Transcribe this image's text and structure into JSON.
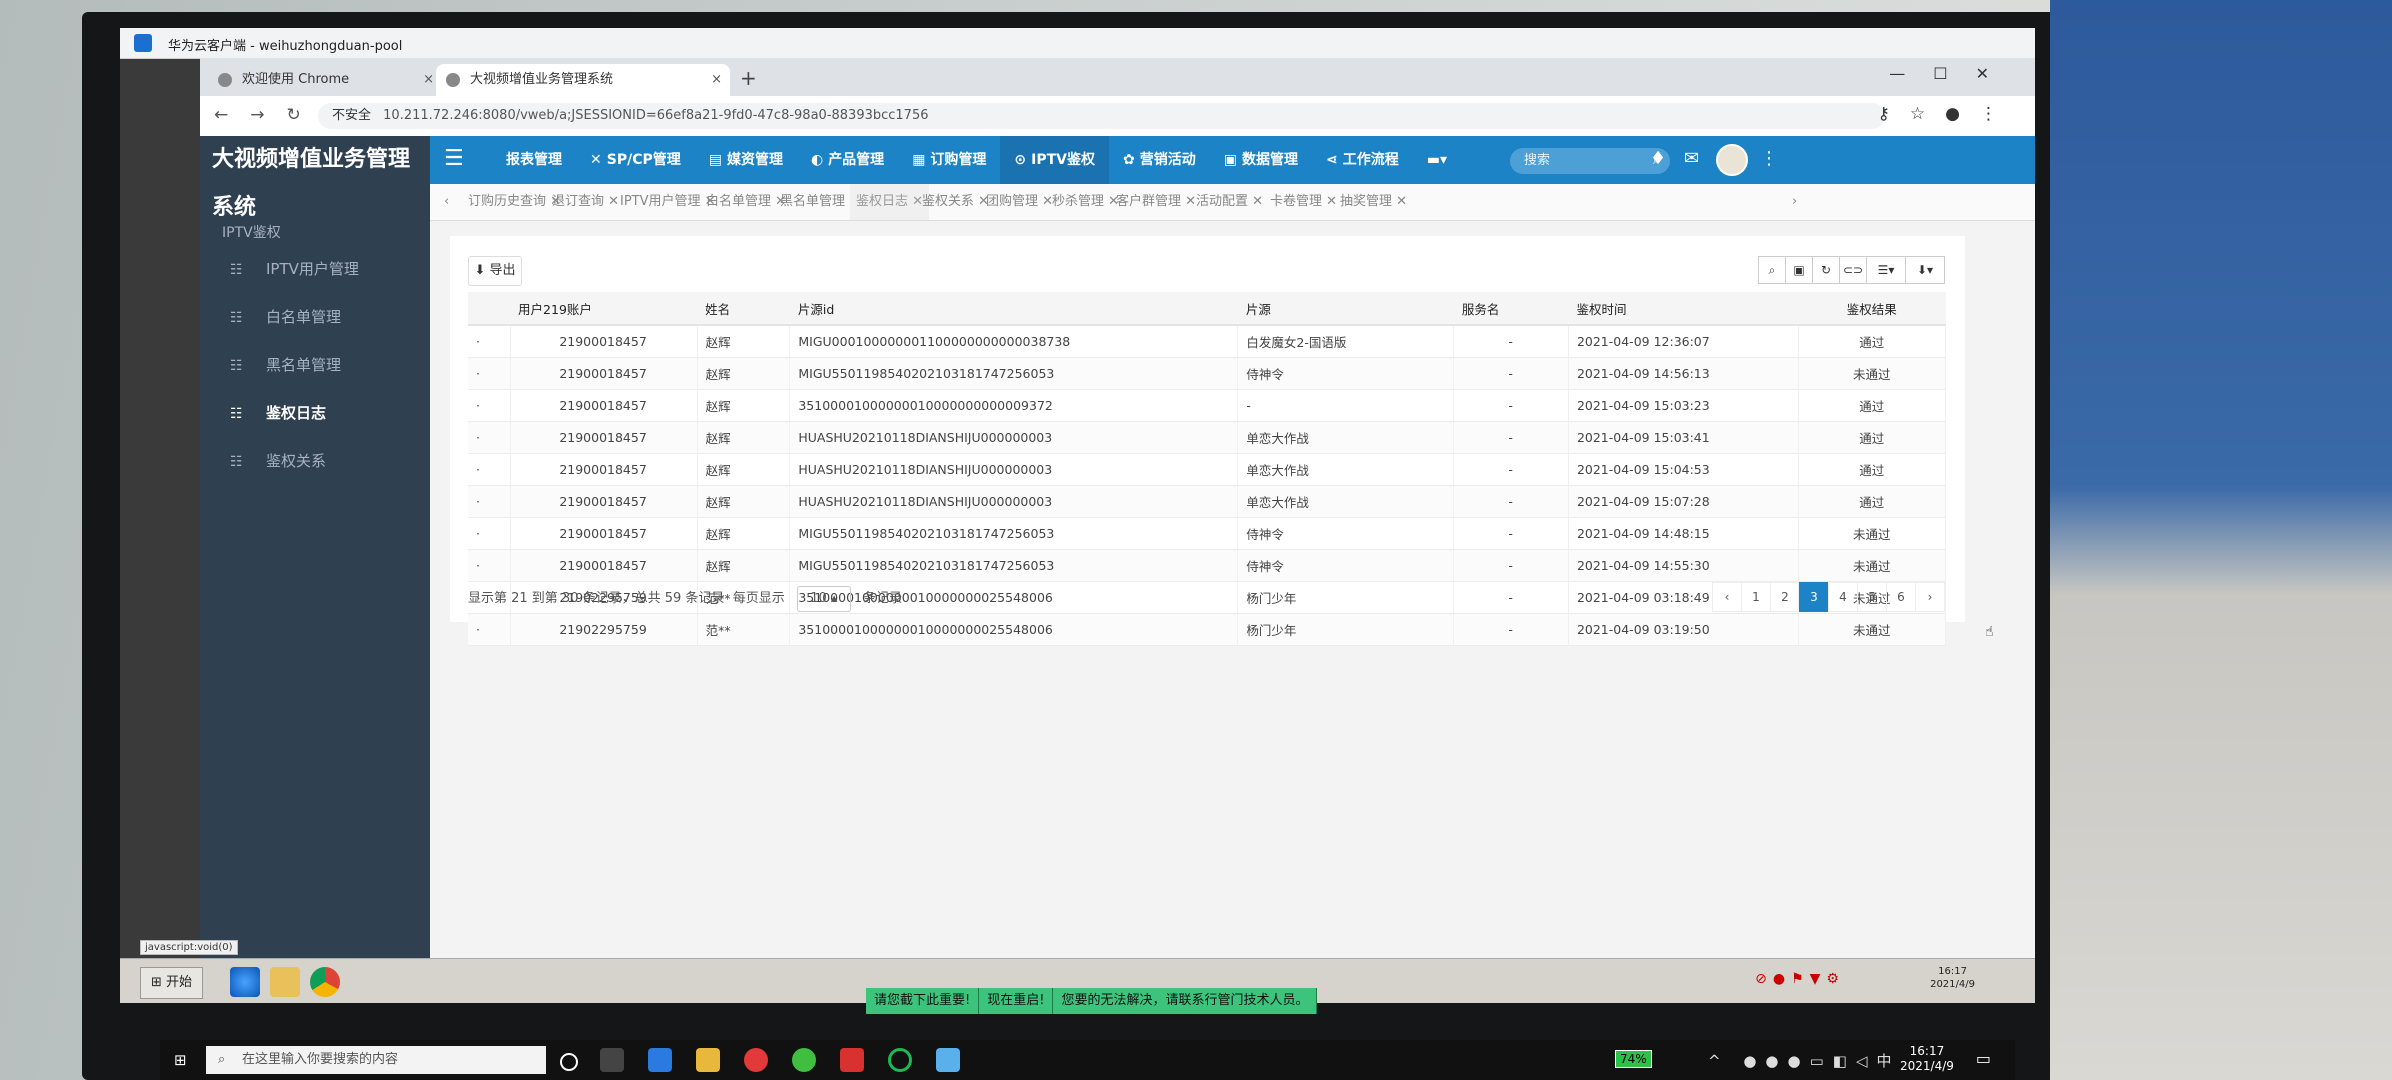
{
  "outer_window": {
    "title": "华为云客户端 - weihuzhongduan-pool"
  },
  "browser": {
    "tabs": [
      {
        "label": "欢迎使用 Chrome"
      },
      {
        "label": "大视频增值业务管理系统"
      }
    ],
    "new_tab": "+",
    "insecure_label": "不安全",
    "url": "10.211.72.246:8080/vweb/a;JSESSIONID=66ef8a21-9fd0-47c8-98a0-88393bcc1756"
  },
  "app": {
    "brand": "大视频增值业务管理系统",
    "sidebar": {
      "heading": "IPTV鉴权",
      "items": [
        {
          "label": "IPTV用户管理"
        },
        {
          "label": "白名单管理"
        },
        {
          "label": "黑名单管理"
        },
        {
          "label": "鉴权日志"
        },
        {
          "label": "鉴权关系"
        }
      ]
    },
    "topnav": [
      {
        "label": "报表管理"
      },
      {
        "label": "SP/CP管理"
      },
      {
        "label": "媒资管理"
      },
      {
        "label": "产品管理"
      },
      {
        "label": "订购管理"
      },
      {
        "label": "IPTV鉴权"
      },
      {
        "label": "营销活动"
      },
      {
        "label": "数据管理"
      },
      {
        "label": "工作流程"
      }
    ],
    "search_placeholder": "搜索",
    "page_tabs": [
      "订购历史查询",
      "退订查询",
      "IPTV用户管理",
      "白名单管理",
      "黑名单管理",
      "鉴权日志",
      "鉴权关系",
      "团购管理",
      "秒杀管理",
      "客户群管理",
      "活动配置",
      "卡卷管理",
      "抽奖管理"
    ],
    "export_label": "导出",
    "table": {
      "headers": [
        "用户219账户",
        "姓名",
        "片源id",
        "片源",
        "服务名",
        "鉴权时间",
        "鉴权结果"
      ],
      "rows": [
        [
          "21900018457",
          "赵辉",
          "MIGU000100000001100000000000038738",
          "白发魔女2-国语版",
          "-",
          "2021-04-09 12:36:07",
          "通过"
        ],
        [
          "21900018457",
          "赵辉",
          "MIGU5501198540202103181747256053",
          "侍神令",
          "-",
          "2021-04-09 14:56:13",
          "未通过"
        ],
        [
          "21900018457",
          "赵辉",
          "35100001000000010000000000009372",
          "-",
          "-",
          "2021-04-09 15:03:23",
          "通过"
        ],
        [
          "21900018457",
          "赵辉",
          "HUASHU20210118DIANSHIJU000000003",
          "单恋大作战",
          "-",
          "2021-04-09 15:03:41",
          "通过"
        ],
        [
          "21900018457",
          "赵辉",
          "HUASHU20210118DIANSHIJU000000003",
          "单恋大作战",
          "-",
          "2021-04-09 15:04:53",
          "通过"
        ],
        [
          "21900018457",
          "赵辉",
          "HUASHU20210118DIANSHIJU000000003",
          "单恋大作战",
          "-",
          "2021-04-09 15:07:28",
          "通过"
        ],
        [
          "21900018457",
          "赵辉",
          "MIGU5501198540202103181747256053",
          "侍神令",
          "-",
          "2021-04-09 14:48:15",
          "未通过"
        ],
        [
          "21900018457",
          "赵辉",
          "MIGU5501198540202103181747256053",
          "侍神令",
          "-",
          "2021-04-09 14:55:30",
          "未通过"
        ],
        [
          "21902295759",
          "范**",
          "35100001000000010000000025548006",
          "杨门少年",
          "-",
          "2021-04-09 03:18:49",
          "未通过"
        ],
        [
          "21902295759",
          "范**",
          "35100001000000010000000025548006",
          "杨门少年",
          "-",
          "2021-04-09 03:19:50",
          "未通过"
        ]
      ]
    },
    "footer": {
      "summary": "显示第 21 到第 30 条记录，总共 59 条记录",
      "per_page_prefix": "每页显示",
      "per_page_value": "10",
      "per_page_suffix": "条记录"
    },
    "pagination": {
      "prev": "‹",
      "pages": [
        "1",
        "2",
        "3",
        "4",
        "5",
        "6"
      ],
      "current": "3",
      "next": "›"
    }
  },
  "xp_taskbar": {
    "status_text": "javascript:void(0)",
    "start_label": "开始",
    "clock_time": "16:17",
    "clock_date": "2021/4/9"
  },
  "notice": [
    "请您截下此重要!",
    "现在重启!",
    "您要的无法解决，请联系行管门技术人员。"
  ],
  "win10_taskbar": {
    "search_placeholder": "在这里输入你要搜索的内容",
    "battery": "74%",
    "ime": "中",
    "time": "16:17",
    "date": "2021/4/9"
  }
}
